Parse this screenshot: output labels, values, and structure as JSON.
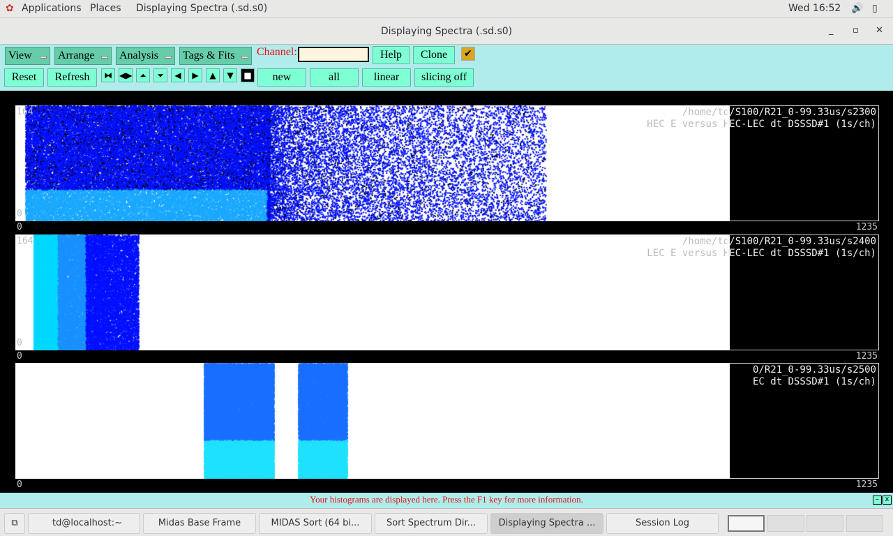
{
  "topbar": {
    "applications": "Applications",
    "places": "Places",
    "window": "Displaying Spectra (.sd.s0)",
    "clock": "Wed 16:52"
  },
  "window": {
    "title": "Displaying Spectra (.sd.s0)",
    "minimize": "_",
    "maximize": "▫",
    "close": "✕"
  },
  "toolbar": {
    "menus": [
      "View",
      "Arrange",
      "Analysis",
      "Tags & Fits"
    ],
    "channel_label": "Channel:",
    "channel_value": "",
    "help": "Help",
    "clone": "Clone",
    "checkbox": "✔",
    "reset": "Reset",
    "refresh": "Refresh",
    "new": "new",
    "all": "all",
    "linear": "linear",
    "slicing": "slicing off"
  },
  "panels": [
    {
      "path": "/home/td/S100/R21_0-99.33us/s2300",
      "desc": "HEC E versus HEC-LEC dt DSSSD#1 (1s/ch)",
      "ymax": "164",
      "ymin": "0",
      "xmin": "0",
      "xmax": "1235"
    },
    {
      "path": "/home/td/S100/R21_0-99.33us/s2400",
      "desc": "LEC E versus HEC-LEC dt DSSSD#1 (1s/ch)",
      "ymax": "164",
      "ymin": "0",
      "xmin": "0",
      "xmax": "1235"
    },
    {
      "path": "0/R21_0-99.33us/s2500",
      "desc": "EC dt DSSSD#1 (1s/ch)",
      "xmin": "0",
      "xmax": "1235"
    }
  ],
  "status": "Your histograms are displayed here. Press the F1 key for more information.",
  "taskbar": [
    "td@localhost:~",
    "Midas Base Frame",
    "MIDAS Sort (64 bi...",
    "Sort Spectrum Dir...",
    "Displaying Spectra ...",
    "Session Log"
  ]
}
